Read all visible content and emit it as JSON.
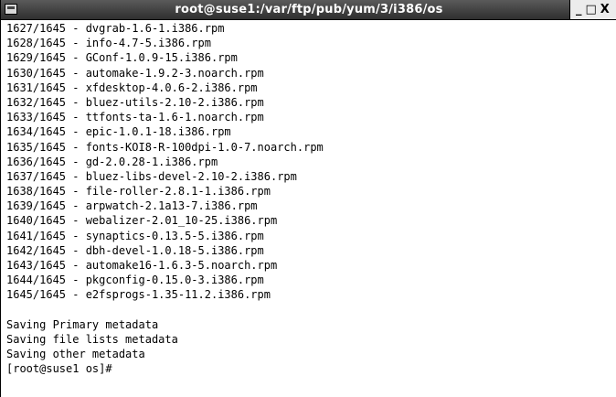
{
  "window": {
    "title": "root@suse1:/var/ftp/pub/yum/3/i386/os",
    "controls": {
      "minimize": "_",
      "maximize": "□",
      "close": "X"
    }
  },
  "terminal": {
    "lines": [
      "1627/1645 - dvgrab-1.6-1.i386.rpm",
      "1628/1645 - info-4.7-5.i386.rpm",
      "1629/1645 - GConf-1.0.9-15.i386.rpm",
      "1630/1645 - automake-1.9.2-3.noarch.rpm",
      "1631/1645 - xfdesktop-4.0.6-2.i386.rpm",
      "1632/1645 - bluez-utils-2.10-2.i386.rpm",
      "1633/1645 - ttfonts-ta-1.6-1.noarch.rpm",
      "1634/1645 - epic-1.0.1-18.i386.rpm",
      "1635/1645 - fonts-KOI8-R-100dpi-1.0-7.noarch.rpm",
      "1636/1645 - gd-2.0.28-1.i386.rpm",
      "1637/1645 - bluez-libs-devel-2.10-2.i386.rpm",
      "1638/1645 - file-roller-2.8.1-1.i386.rpm",
      "1639/1645 - arpwatch-2.1a13-7.i386.rpm",
      "1640/1645 - webalizer-2.01_10-25.i386.rpm",
      "1641/1645 - synaptics-0.13.5-5.i386.rpm",
      "1642/1645 - dbh-devel-1.0.18-5.i386.rpm",
      "1643/1645 - automake16-1.6.3-5.noarch.rpm",
      "1644/1645 - pkgconfig-0.15.0-3.i386.rpm",
      "1645/1645 - e2fsprogs-1.35-11.2.i386.rpm",
      "",
      "Saving Primary metadata",
      "Saving file lists metadata",
      "Saving other metadata",
      "[root@suse1 os]#"
    ]
  }
}
